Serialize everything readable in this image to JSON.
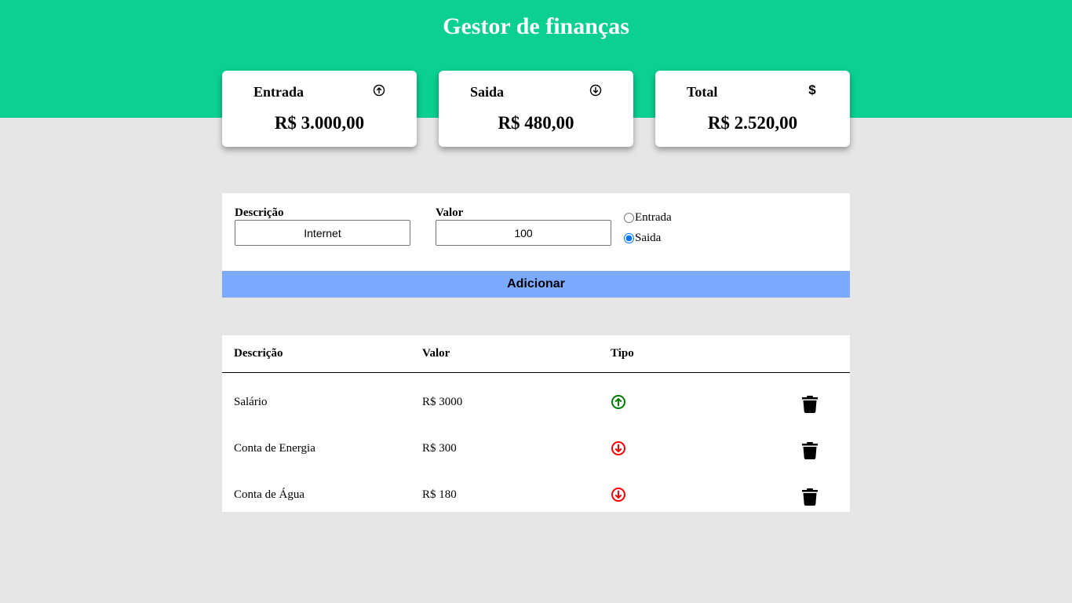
{
  "header": {
    "title": "Gestor de finanças",
    "bg_color": "#0bd08f"
  },
  "cards": [
    {
      "title": "Entrada",
      "icon": "arrow-up-circle-icon",
      "value": "R$ 3.000,00"
    },
    {
      "title": "Saida",
      "icon": "arrow-down-circle-icon",
      "value": "R$ 480,00"
    },
    {
      "title": "Total",
      "icon": "dollar-icon",
      "value": "R$ 2.520,00"
    }
  ],
  "form": {
    "description_label": "Descrição",
    "description_value": "Internet",
    "value_label": "Valor",
    "value_value": "100",
    "radio_entrada_label": "Entrada",
    "radio_saida_label": "Saida",
    "selected_type": "Saida",
    "add_button_label": "Adicionar",
    "add_button_color": "#7baaff"
  },
  "table": {
    "headers": [
      "Descrição",
      "Valor",
      "Tipo"
    ],
    "rows": [
      {
        "description": "Salário",
        "value": "R$ 3000",
        "type": "entrada",
        "type_icon": "arrow-up-circle-icon",
        "type_color": "#008000"
      },
      {
        "description": "Conta de Energia",
        "value": "R$ 300",
        "type": "saida",
        "type_icon": "arrow-down-circle-icon",
        "type_color": "#ff0000"
      },
      {
        "description": "Conta de Água",
        "value": "R$ 180",
        "type": "saida",
        "type_icon": "arrow-down-circle-icon",
        "type_color": "#ff0000"
      }
    ],
    "delete_icon": "trash-icon"
  }
}
